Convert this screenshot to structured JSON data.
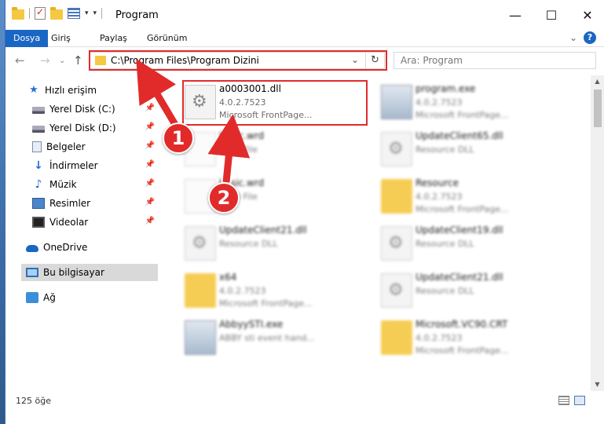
{
  "window": {
    "title": "Program"
  },
  "ribbon": {
    "tabs": [
      "Dosya",
      "Giriş",
      "Paylaş",
      "Görünüm"
    ],
    "help": "?"
  },
  "nav": {
    "address": "C:\\Program Files\\Program Dizini",
    "search_placeholder": "Ara: Program"
  },
  "sidebar": {
    "items": [
      {
        "label": "Hızlı erişim",
        "icon": "star-icon"
      },
      {
        "label": "Yerel Disk (C:)",
        "icon": "drive-icon"
      },
      {
        "label": "Yerel Disk (D:)",
        "icon": "drive-icon"
      },
      {
        "label": "Belgeler",
        "icon": "documents-icon"
      },
      {
        "label": "İndirmeler",
        "icon": "download-icon"
      },
      {
        "label": "Müzik",
        "icon": "music-icon"
      },
      {
        "label": "Resimler",
        "icon": "pictures-icon"
      },
      {
        "label": "Videolar",
        "icon": "videos-icon"
      },
      {
        "label": "OneDrive",
        "icon": "cloud-icon"
      },
      {
        "label": "Bu bilgisayar",
        "icon": "computer-icon"
      },
      {
        "label": "Ağ",
        "icon": "network-icon"
      }
    ]
  },
  "files": [
    {
      "name": "a0003001.dll",
      "line1": "4.0.2.7523",
      "line2": "Microsoft FrontPage...",
      "icon": "dll-icon"
    },
    {
      "name": "program.exe",
      "line1": "4.0.2.7523",
      "line2": "Microsoft FrontPage...",
      "icon": "exe-icon"
    },
    {
      "name": "basic.wrd",
      "line1": "WRD File",
      "line2": "",
      "icon": "file-icon"
    },
    {
      "name": "UpdateClient65.dll",
      "line1": "Resource DLL",
      "line2": "",
      "icon": "dll-icon"
    },
    {
      "name": "basic.wrd",
      "line1": "WRD File",
      "line2": "",
      "icon": "file-icon"
    },
    {
      "name": "Resource",
      "line1": "4.0.2.7523",
      "line2": "Microsoft FrontPage...",
      "icon": "folder-icon"
    },
    {
      "name": "UpdateClient21.dll",
      "line1": "Resource DLL",
      "line2": "",
      "icon": "dll-icon"
    },
    {
      "name": "UpdateClient19.dll",
      "line1": "Resource DLL",
      "line2": "",
      "icon": "dll-icon"
    },
    {
      "name": "x64",
      "line1": "4.0.2.7523",
      "line2": "Microsoft FrontPage...",
      "icon": "folder-icon"
    },
    {
      "name": "UpdateClient21.dll",
      "line1": "Resource DLL",
      "line2": "",
      "icon": "dll-icon"
    },
    {
      "name": "AbbyySTI.exe",
      "line1": "ABBY sti event hand...",
      "line2": "",
      "icon": "exe-icon"
    },
    {
      "name": "Microsoft.VC90.CRT",
      "line1": "4.0.2.7523",
      "line2": "Microsoft FrontPage...",
      "icon": "folder-icon"
    }
  ],
  "status": {
    "count": "125 öğe"
  },
  "annotations": {
    "step1": "1",
    "step2": "2",
    "color": "#e12b2b"
  }
}
